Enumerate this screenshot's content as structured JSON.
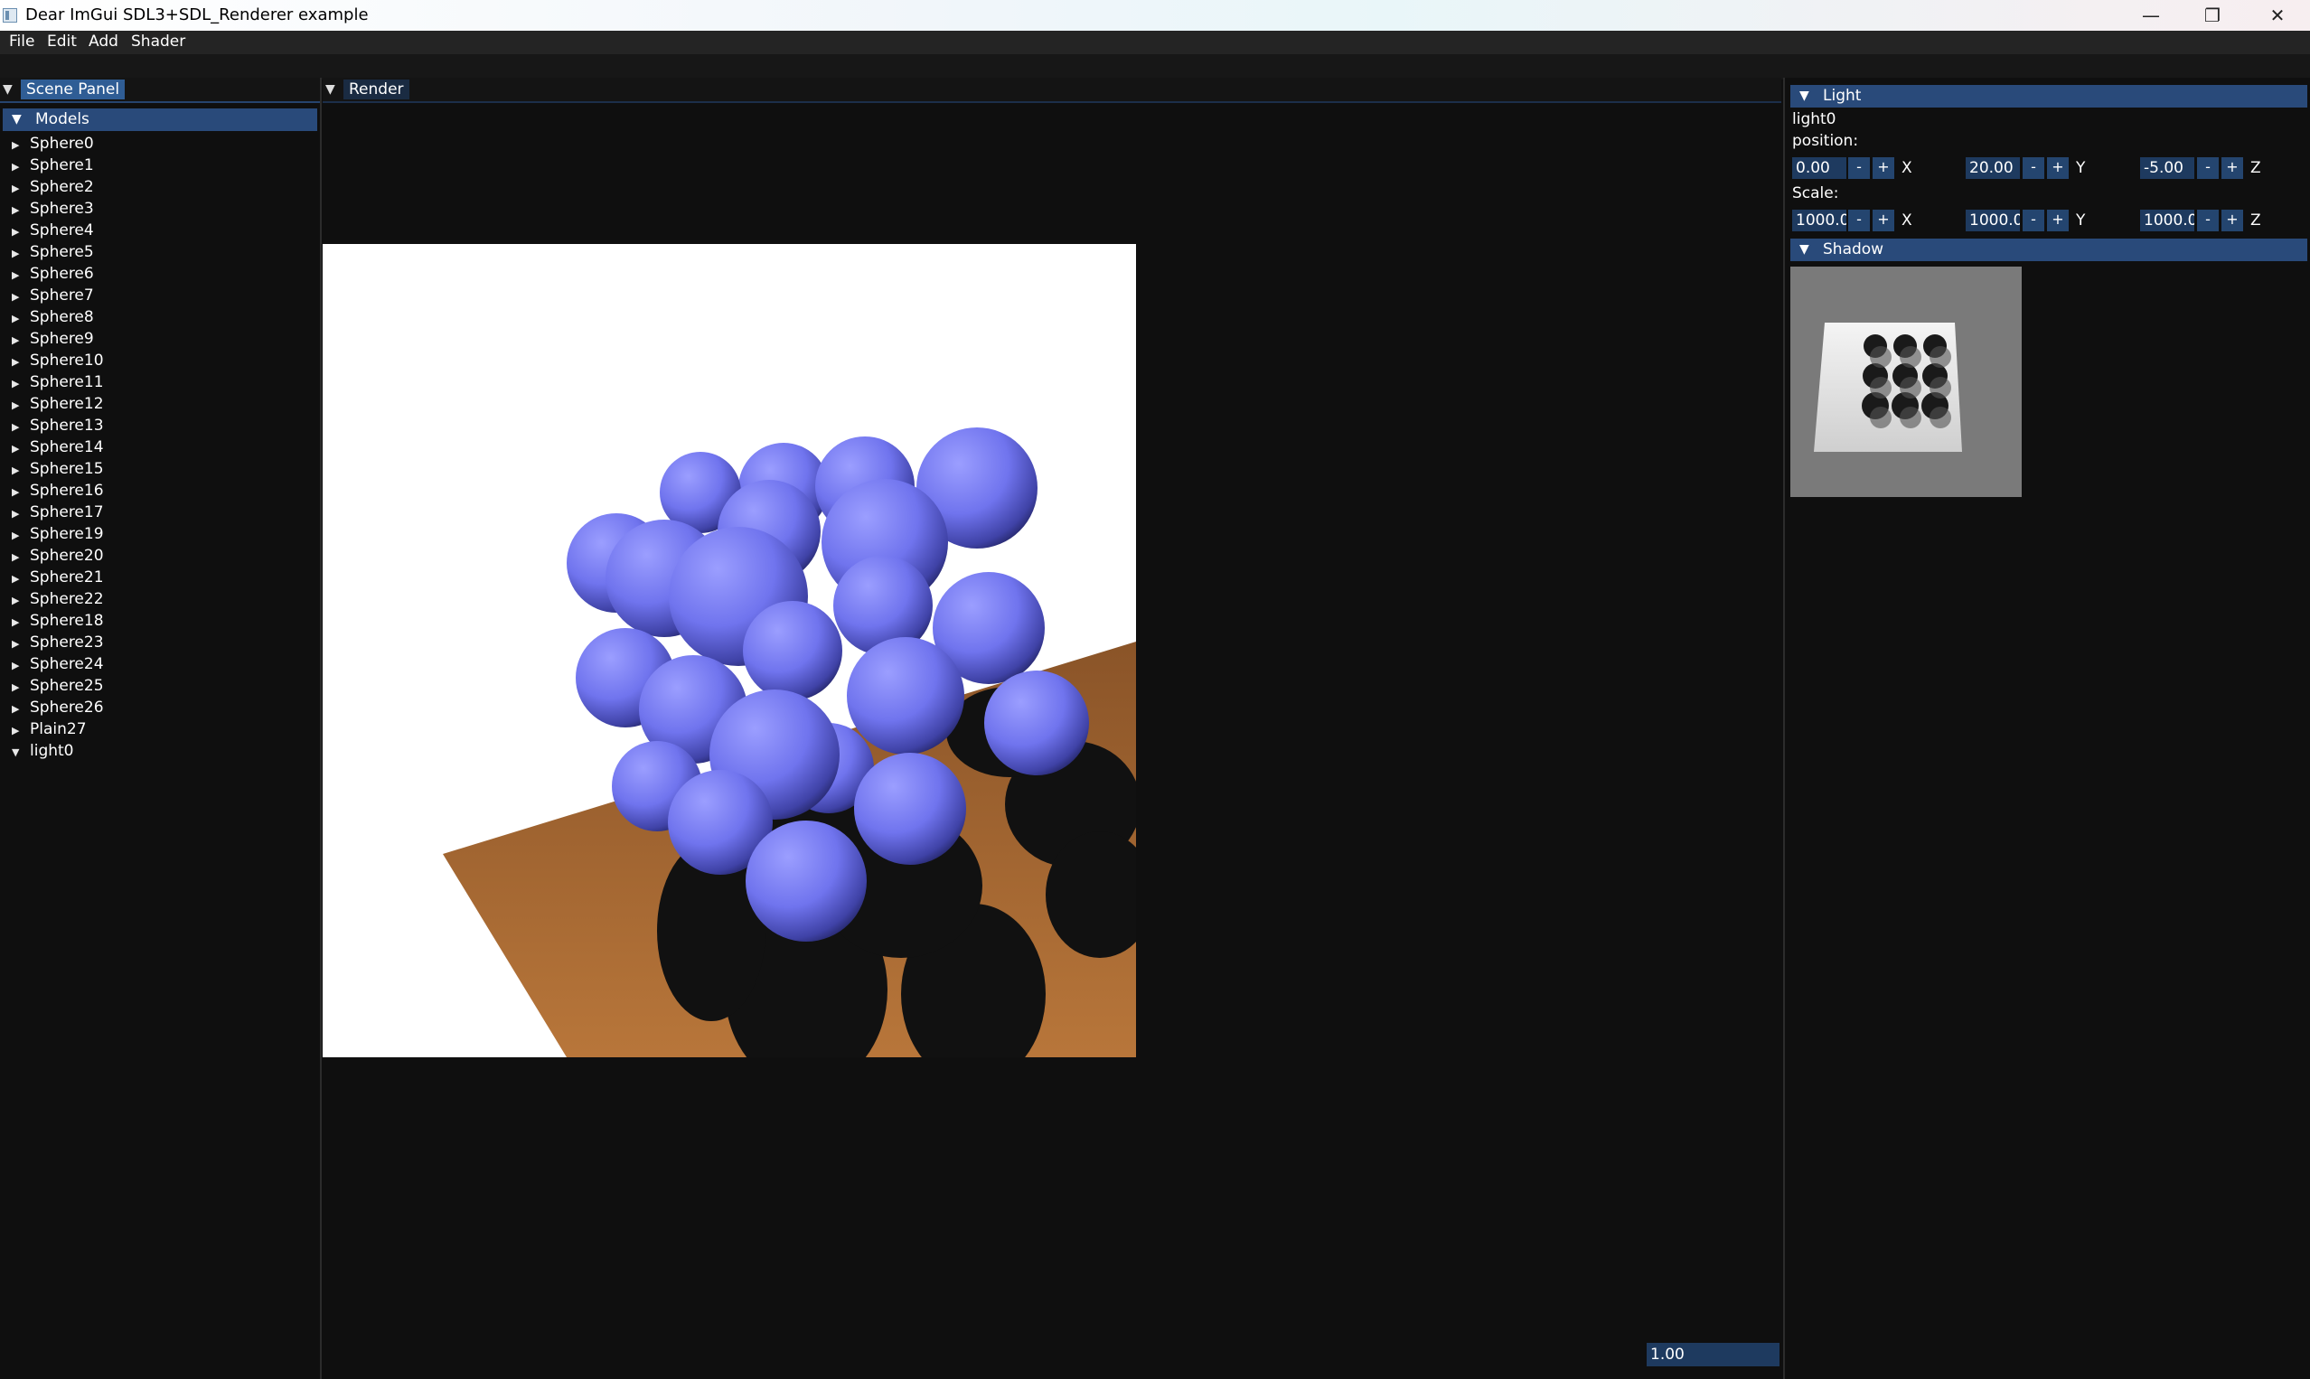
{
  "window": {
    "title": "Dear ImGui SDL3+SDL_Renderer example",
    "minimize_glyph": "—",
    "maximize_glyph": "❐",
    "close_glyph": "✕"
  },
  "menu": [
    "File",
    "Edit",
    "Add",
    "Shader"
  ],
  "scene_panel": {
    "tab": "Scene Panel",
    "models_header": "Models",
    "items": [
      "Sphere0",
      "Sphere1",
      "Sphere2",
      "Sphere3",
      "Sphere4",
      "Sphere5",
      "Sphere6",
      "Sphere7",
      "Sphere8",
      "Sphere9",
      "Sphere10",
      "Sphere11",
      "Sphere12",
      "Sphere13",
      "Sphere14",
      "Sphere15",
      "Sphere16",
      "Sphere17",
      "Sphere19",
      "Sphere20",
      "Sphere21",
      "Sphere22",
      "Sphere18",
      "Sphere23",
      "Sphere24",
      "Sphere25",
      "Sphere26",
      "Plain27",
      "light0"
    ]
  },
  "render_panel": {
    "tab": "Render",
    "zoom_value": "1.00"
  },
  "light_panel": {
    "header": "Light",
    "name": "light0",
    "position_label": "position:",
    "position": {
      "x": "0.00",
      "y": "20.00",
      "z": "-5.00"
    },
    "scale_label": "Scale:",
    "scale": {
      "x": "1000.0(",
      "y": "1000.0(",
      "z": "1000.0("
    },
    "axis_x": "X",
    "axis_y": "Y",
    "axis_z": "Z",
    "minus": "-",
    "plus": "+",
    "shadow_header": "Shadow"
  },
  "colors": {
    "sphere": "#7074ee",
    "floor": "#a9692f",
    "header": "#294a7a",
    "field": "#1e3a5f",
    "tab_active": "#2f5d95"
  }
}
